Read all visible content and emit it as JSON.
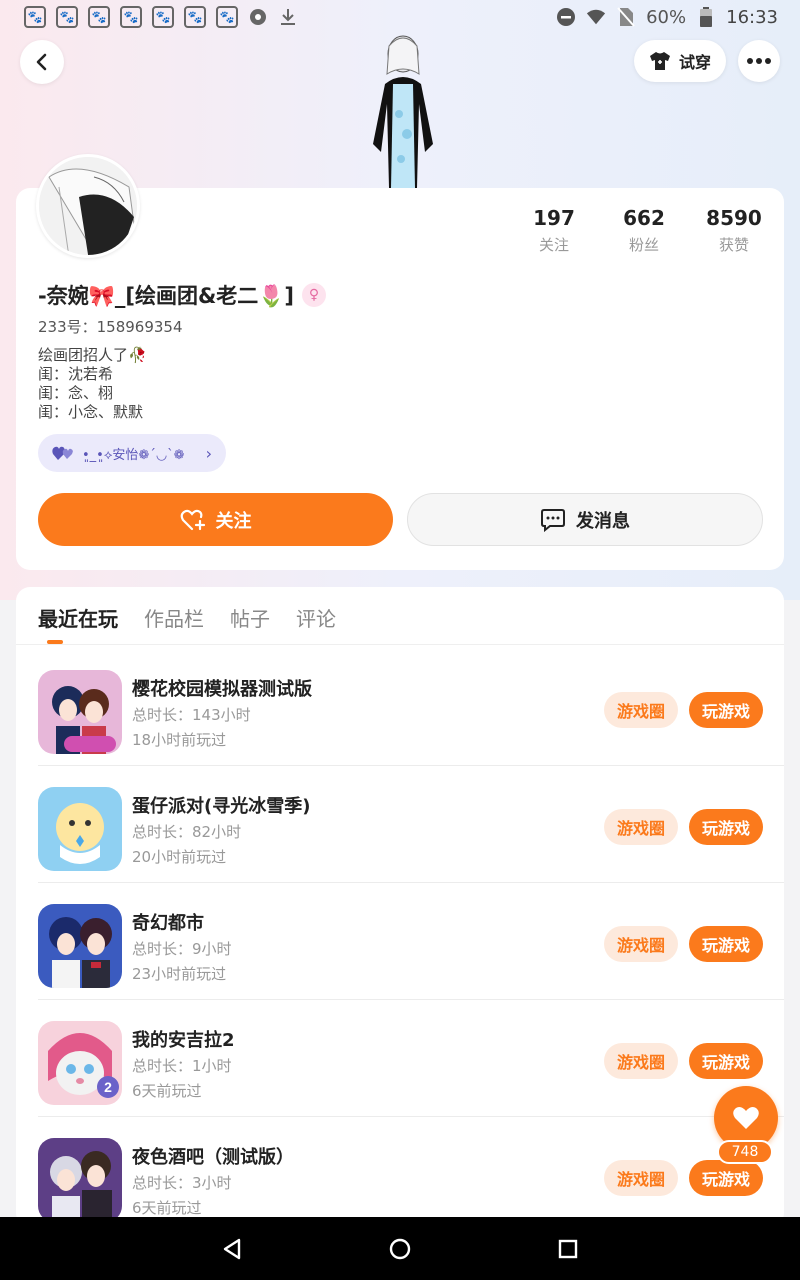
{
  "status_bar": {
    "battery": "60%",
    "time": "16:33",
    "app_icon_count": 7
  },
  "header": {
    "try_on_label": "试穿"
  },
  "profile": {
    "stats": [
      {
        "num": "197",
        "label": "关注"
      },
      {
        "num": "662",
        "label": "粉丝"
      },
      {
        "num": "8590",
        "label": "获赞"
      }
    ],
    "username": "-奈婉🎀_[绘画团&老二🌷]",
    "uid": "233号：158969354",
    "bio_lines": [
      "绘画团招人了🥀",
      "闺：沈若希",
      "闺：念、栩",
      "闺：小念、默默"
    ],
    "tag": "•͈_•͈⟡安怡❁´◡`❁",
    "follow_label": "关注",
    "message_label": "发消息"
  },
  "tabs": [
    {
      "label": "最近在玩",
      "active": true
    },
    {
      "label": "作品栏",
      "active": false
    },
    {
      "label": "帖子",
      "active": false
    },
    {
      "label": "评论",
      "active": false
    }
  ],
  "games": [
    {
      "title": "樱花校园模拟器测试版",
      "total": "总时长：143小时",
      "last": "18小时前玩过",
      "icon": "sakura-school-icon",
      "icon_color": "#c64aa8"
    },
    {
      "title": "蛋仔派对(寻光冰雪季)",
      "total": "总时长：82小时",
      "last": "20小时前玩过",
      "icon": "eggy-party-icon",
      "icon_color": "#7cc7ef"
    },
    {
      "title": "奇幻都市",
      "total": "总时长：9小时",
      "last": "23小时前玩过",
      "icon": "fantasy-city-icon",
      "icon_color": "#2f4fa8"
    },
    {
      "title": "我的安吉拉2",
      "total": "总时长：1小时",
      "last": "6天前玩过",
      "icon": "my-angela-icon",
      "icon_color": "#f2a7c2"
    },
    {
      "title": "夜色酒吧（测试版）",
      "total": "总时长：3小时",
      "last": "6天前玩过",
      "icon": "night-bar-icon",
      "icon_color": "#6a4d8f"
    }
  ],
  "game_buttons": {
    "circle_label": "游戏圈",
    "play_label": "玩游戏"
  },
  "like_count": "748",
  "colors": {
    "accent": "#fb7a1c",
    "accent_light": "#fde9dc"
  }
}
